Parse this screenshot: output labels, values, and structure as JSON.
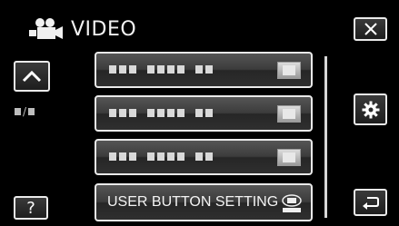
{
  "header": {
    "title": "VIDEO",
    "icon": "video-camera-icon"
  },
  "controls": {
    "close": "close-icon",
    "up": "chevron-up-icon",
    "settings": "gear-icon",
    "help_label": "?",
    "back": "return-icon"
  },
  "menu": {
    "items": [
      {
        "value": ""
      },
      {
        "value": ""
      },
      {
        "value": ""
      },
      {
        "label": "USER BUTTON SETTING",
        "icon": "user-button-icon"
      }
    ]
  },
  "colors": {
    "background": "#000000",
    "border": "#e9e9e9",
    "text": "#f3f3f3"
  }
}
